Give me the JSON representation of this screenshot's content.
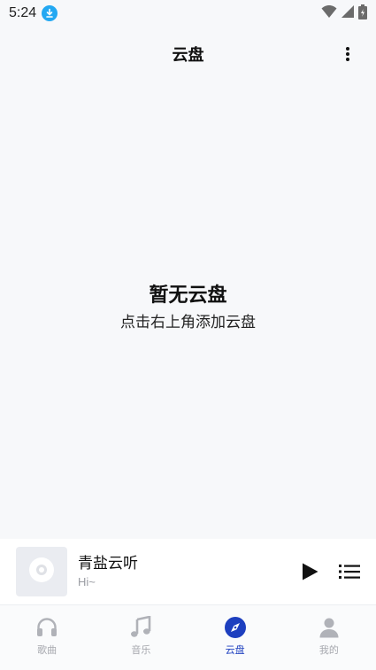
{
  "status_bar": {
    "time": "5:24",
    "icons": [
      "download-icon",
      "wifi-icon",
      "signal-icon",
      "battery-charging-icon"
    ]
  },
  "app_bar": {
    "title": "云盘",
    "menu_icon": "more-vert-icon"
  },
  "empty_state": {
    "title": "暂无云盘",
    "subtitle": "点击右上角添加云盘"
  },
  "player": {
    "title": "青盐云听",
    "subtitle": "Hi~",
    "cover_icon": "disc-icon",
    "play_icon": "play-icon",
    "playlist_icon": "playlist-icon"
  },
  "nav": {
    "items": [
      {
        "label": "歌曲",
        "icon": "headphones-icon",
        "active": false
      },
      {
        "label": "音乐",
        "icon": "music-note-icon",
        "active": false
      },
      {
        "label": "云盘",
        "icon": "compass-icon",
        "active": true
      },
      {
        "label": "我的",
        "icon": "person-icon",
        "active": false
      }
    ]
  },
  "colors": {
    "accent": "#1d3fbf",
    "background": "#f7f8fa",
    "inactive": "#a6a8ae",
    "download_badge": "#23a8f2"
  }
}
